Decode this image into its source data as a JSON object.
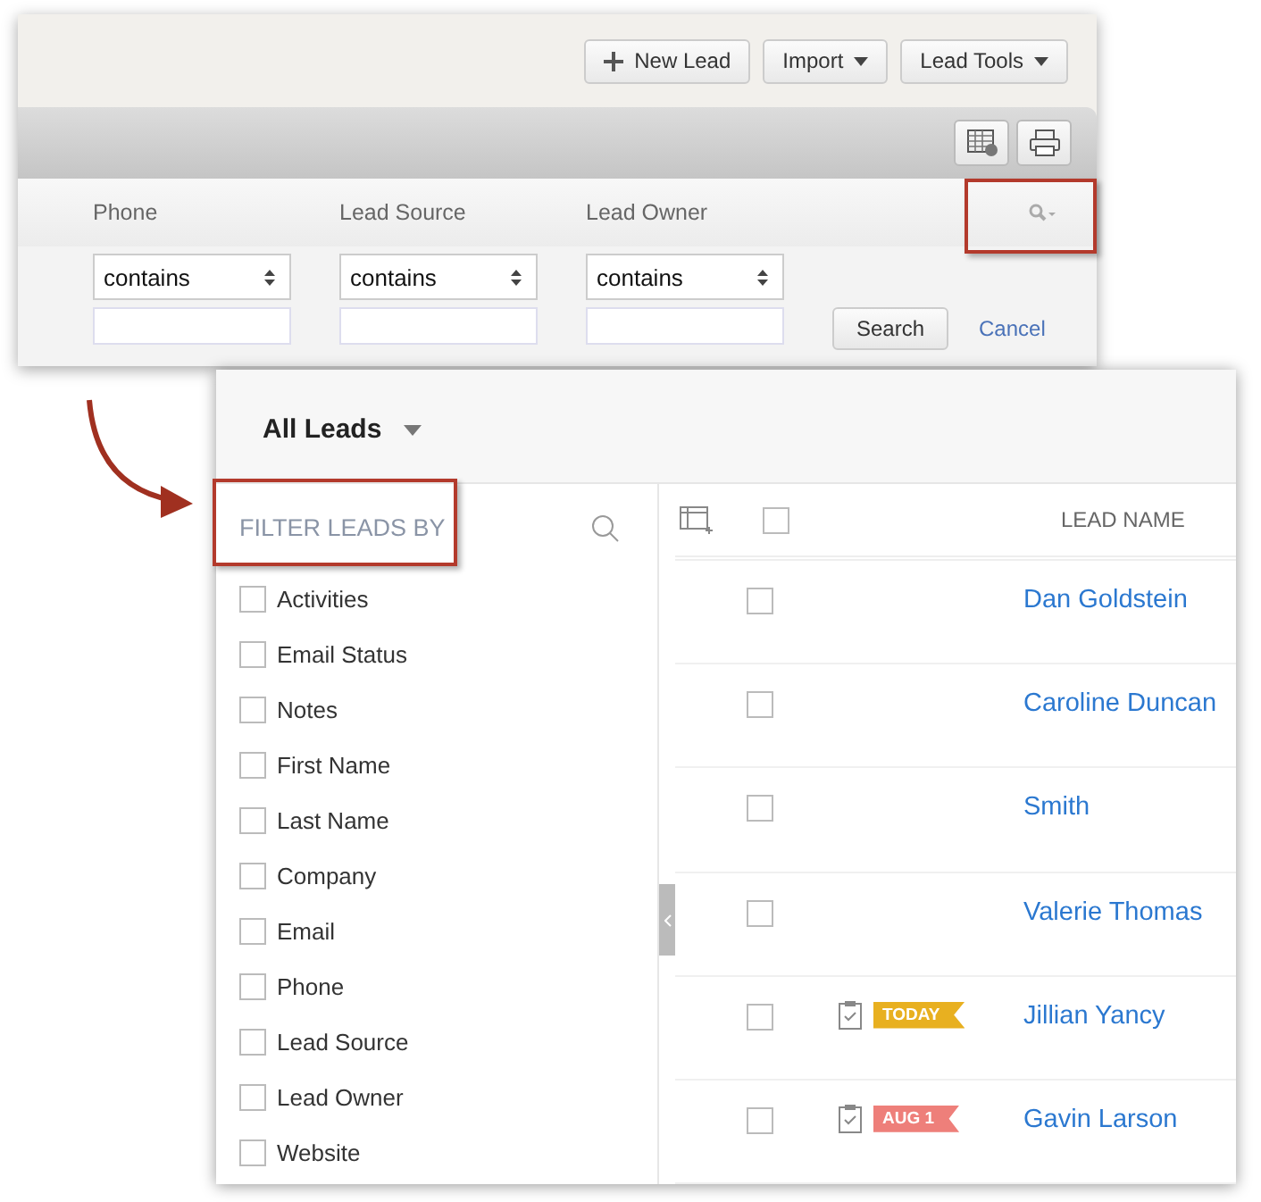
{
  "top_panel": {
    "buttons": [
      {
        "label": "New Lead",
        "kind": "plus"
      },
      {
        "label": "Import",
        "kind": "menu"
      },
      {
        "label": "Lead Tools",
        "kind": "menu"
      }
    ],
    "filter_columns": [
      {
        "heading": "Phone",
        "operator": "contains"
      },
      {
        "heading": "Lead Source",
        "operator": "contains"
      },
      {
        "heading": "Lead Owner",
        "operator": "contains"
      }
    ],
    "search_button": "Search",
    "cancel_link": "Cancel"
  },
  "leads_panel": {
    "view": "All Leads",
    "filter_heading": "FILTER LEADS BY",
    "filters": [
      {
        "label": "Activities",
        "checked": false
      },
      {
        "label": "Email Status",
        "checked": false
      },
      {
        "label": "Notes",
        "checked": false
      },
      {
        "label": "First Name",
        "checked": false
      },
      {
        "label": "Last Name",
        "checked": false
      },
      {
        "label": "Company",
        "checked": false
      },
      {
        "label": "Email",
        "checked": false
      },
      {
        "label": "Phone",
        "checked": false
      },
      {
        "label": "Lead Source",
        "checked": false
      },
      {
        "label": "Lead Owner",
        "checked": false
      },
      {
        "label": "Website",
        "checked": false
      }
    ],
    "column_heading": "LEAD NAME",
    "select_all_checked": false,
    "rows": [
      {
        "name": "Dan Goldstein",
        "checked": false
      },
      {
        "name": "Caroline Duncan",
        "checked": false
      },
      {
        "name": "Smith",
        "checked": false
      },
      {
        "name": "Valerie Thomas",
        "checked": false
      },
      {
        "name": "Jillian Yancy",
        "checked": false,
        "task": {
          "label": "TODAY",
          "color": "#e8b020"
        }
      },
      {
        "name": "Gavin Larson",
        "checked": false,
        "task": {
          "label": "AUG 1",
          "color": "#ee7f7a"
        }
      }
    ]
  }
}
